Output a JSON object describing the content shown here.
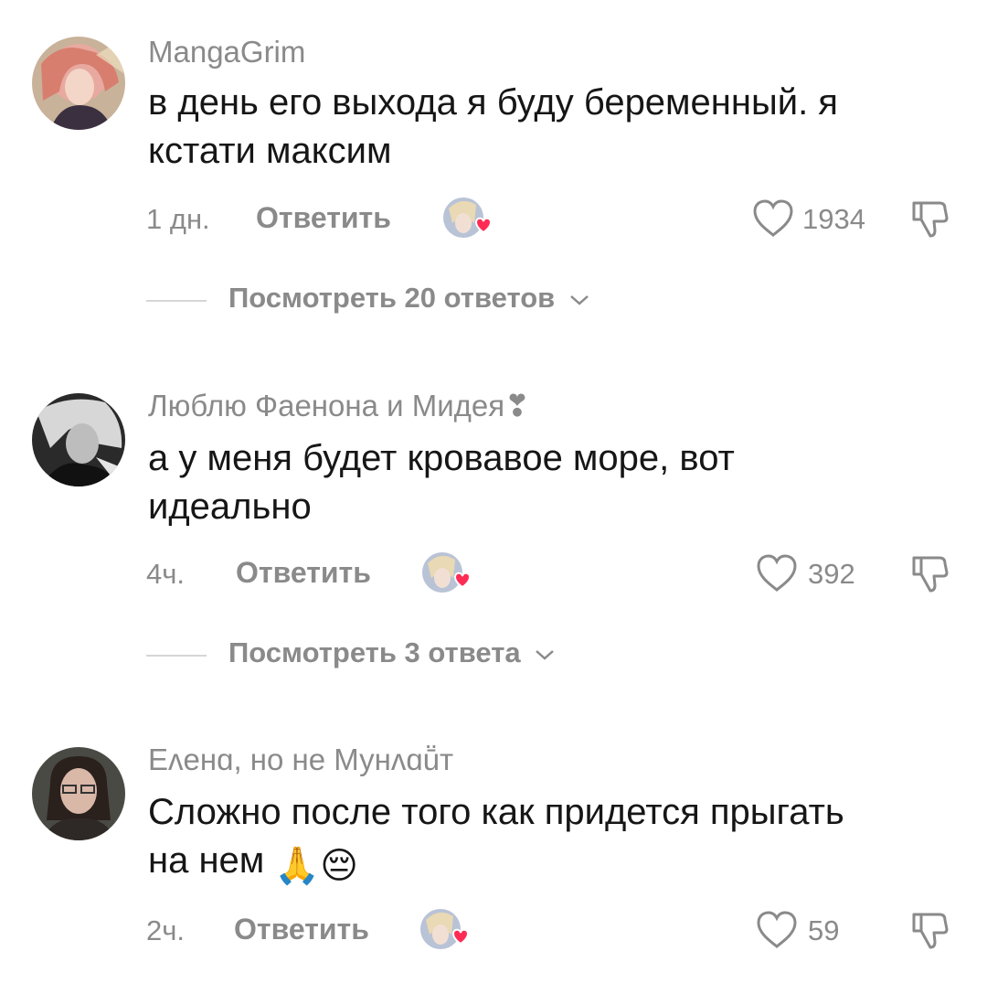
{
  "comments": [
    {
      "username": "MangaGrim",
      "text_line1": "в день его выхода я буду беременный. я",
      "text_line2": "кстати максим",
      "time": "1 дн.",
      "reply_label": "Ответить",
      "likes": "1934",
      "view_replies": "Посмотреть 20 ответов"
    },
    {
      "username": "Люблю Фаенона и Мидея❣",
      "text_line1": "а у меня будет кровавое море, вот",
      "text_line2": "идеально",
      "time": "4ч.",
      "reply_label": "Ответить",
      "likes": "392",
      "view_replies": "Посмотреть 3 ответа"
    },
    {
      "username": "Eʌенɑ, но не Мунʌɑṻт",
      "text_line1": "Сложно после того как придется прыгать",
      "text_line2": "на нем",
      "emojis": "🙏😔",
      "time": "2ч.",
      "reply_label": "Ответить",
      "likes": "59"
    }
  ],
  "colors": {
    "muted": "#8a8a8a",
    "text": "#161616",
    "heart_badge": "#fe2c55"
  }
}
